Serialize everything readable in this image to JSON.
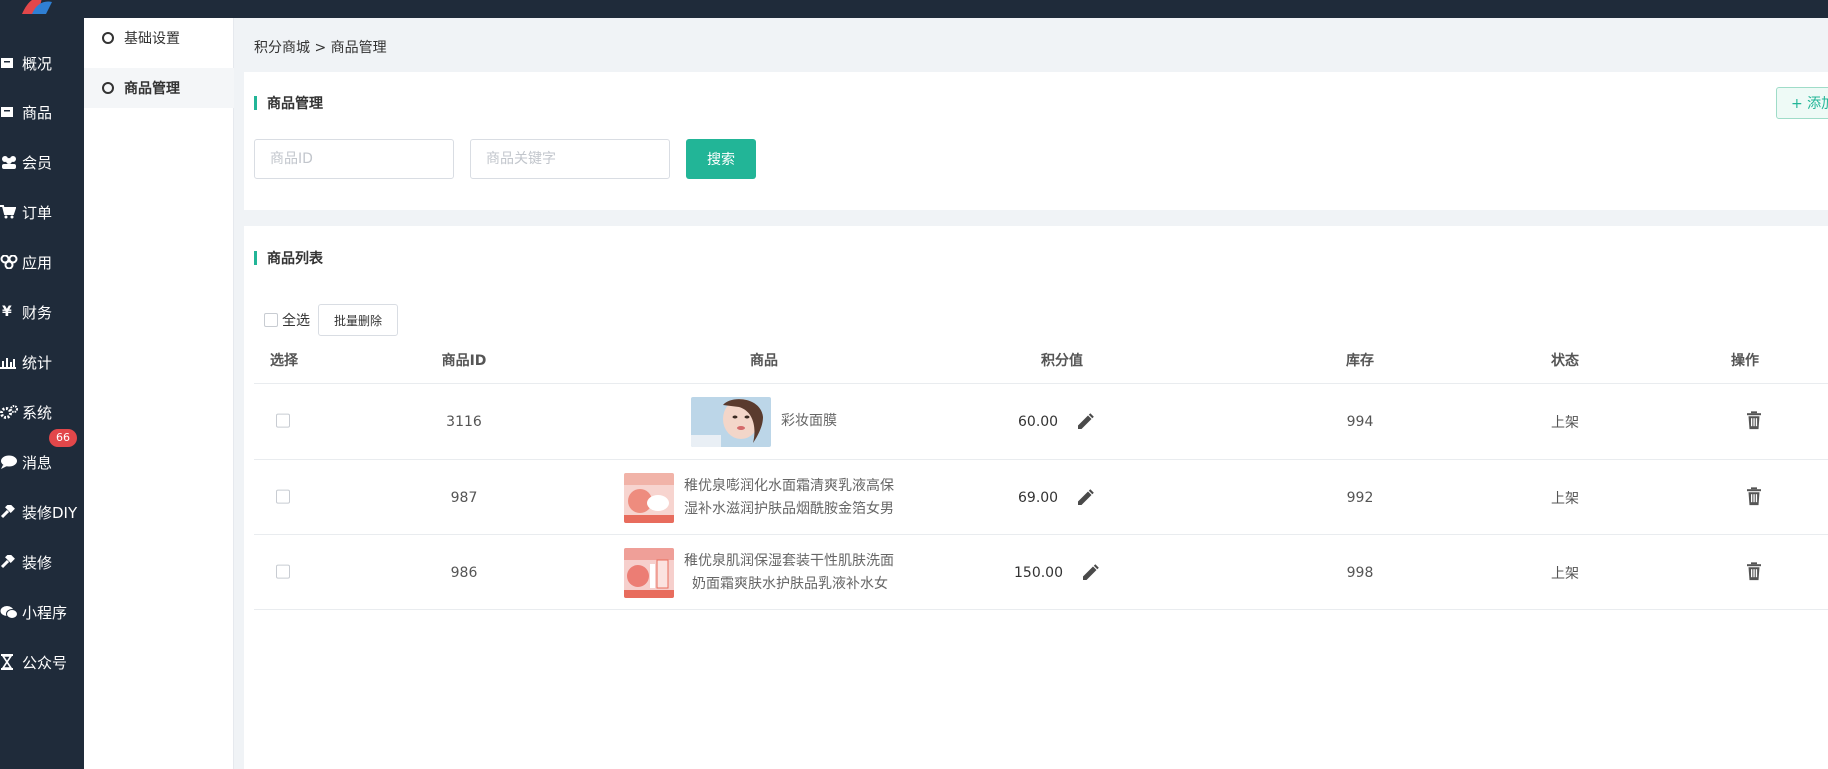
{
  "sidebar": {
    "items": [
      {
        "icon": "box-icon",
        "label": "概况"
      },
      {
        "icon": "box-icon",
        "label": "商品"
      },
      {
        "icon": "users-icon",
        "label": "会员"
      },
      {
        "icon": "cart-icon",
        "label": "订单"
      },
      {
        "icon": "apps-icon",
        "label": "应用"
      },
      {
        "icon": "yen-icon",
        "label": "财务"
      },
      {
        "icon": "bar-chart-icon",
        "label": "统计"
      },
      {
        "icon": "gears-icon",
        "label": "系统"
      },
      {
        "icon": "chat-icon",
        "label": "消息"
      },
      {
        "icon": "hammer-icon",
        "label": "装修DIY"
      },
      {
        "icon": "hammer-icon",
        "label": "装修"
      },
      {
        "icon": "wechat-icon",
        "label": "小程序"
      },
      {
        "icon": "hourglass-icon",
        "label": "公众号"
      }
    ],
    "message_badge": "66"
  },
  "subnav": {
    "items": [
      {
        "label": "基础设置",
        "active": false
      },
      {
        "label": "商品管理",
        "active": true
      }
    ]
  },
  "breadcrumb": "积分商城 > 商品管理",
  "filter": {
    "title": "商品管理",
    "add_label": "+ 添加",
    "id_placeholder": "商品ID",
    "keyword_placeholder": "商品关键字",
    "search_label": "搜索"
  },
  "list": {
    "title": "商品列表",
    "select_all": "全选",
    "batch_delete": "批量删除",
    "columns": [
      "选择",
      "商品ID",
      "商品",
      "积分值",
      "库存",
      "状态",
      "操作"
    ],
    "rows": [
      {
        "id": "3116",
        "name_line1": "彩妆面膜",
        "name_line2": "",
        "points": "60.00",
        "stock": "994",
        "status": "上架"
      },
      {
        "id": "987",
        "name_line1": "稚优泉嘭润化水面霜清爽乳液高保",
        "name_line2": "湿补水滋润护肤品烟酰胺金箔女男",
        "points": "69.00",
        "stock": "992",
        "status": "上架"
      },
      {
        "id": "986",
        "name_line1": "稚优泉肌润保湿套装干性肌肤洗面",
        "name_line2": "奶面霜爽肤水护肤品乳液补水女",
        "points": "150.00",
        "stock": "998",
        "status": "上架"
      }
    ]
  },
  "colors": {
    "accent": "#22b597",
    "sidebar_bg": "#1f2b3a",
    "badge": "#e2474a"
  }
}
